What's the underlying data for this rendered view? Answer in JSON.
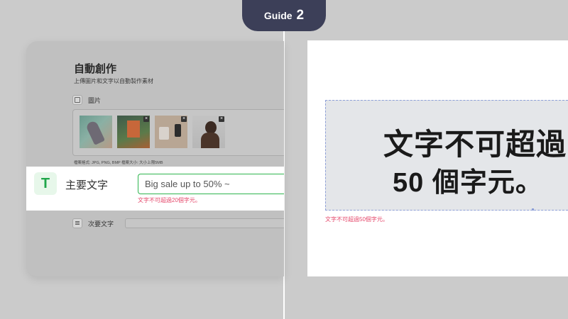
{
  "guide": {
    "label": "Guide",
    "number": "2"
  },
  "form": {
    "title": "自動創作",
    "subtitle": "上傳圖片和文字以自動製作素材",
    "images": {
      "label": "圖片",
      "formats_note": "檔案格式: JPG, PNG, BMP 檔案大小: 大小上限5MB",
      "remove_glyph": "×"
    },
    "main_text": {
      "icon_glyph": "T",
      "label": "主要文字",
      "value": "Big sale up to 50% ~",
      "error": "文字不可超過20個字元。"
    },
    "sub_text": {
      "label": "次要文字",
      "value": ""
    }
  },
  "preview": {
    "line1": "文字不可超過",
    "line2": "50 個字元。",
    "error": "文字不可超過50個字元。"
  },
  "colors": {
    "accent_green": "#1fa64a",
    "error_pink": "#e5486b",
    "guide_bg": "#3c3f58"
  }
}
